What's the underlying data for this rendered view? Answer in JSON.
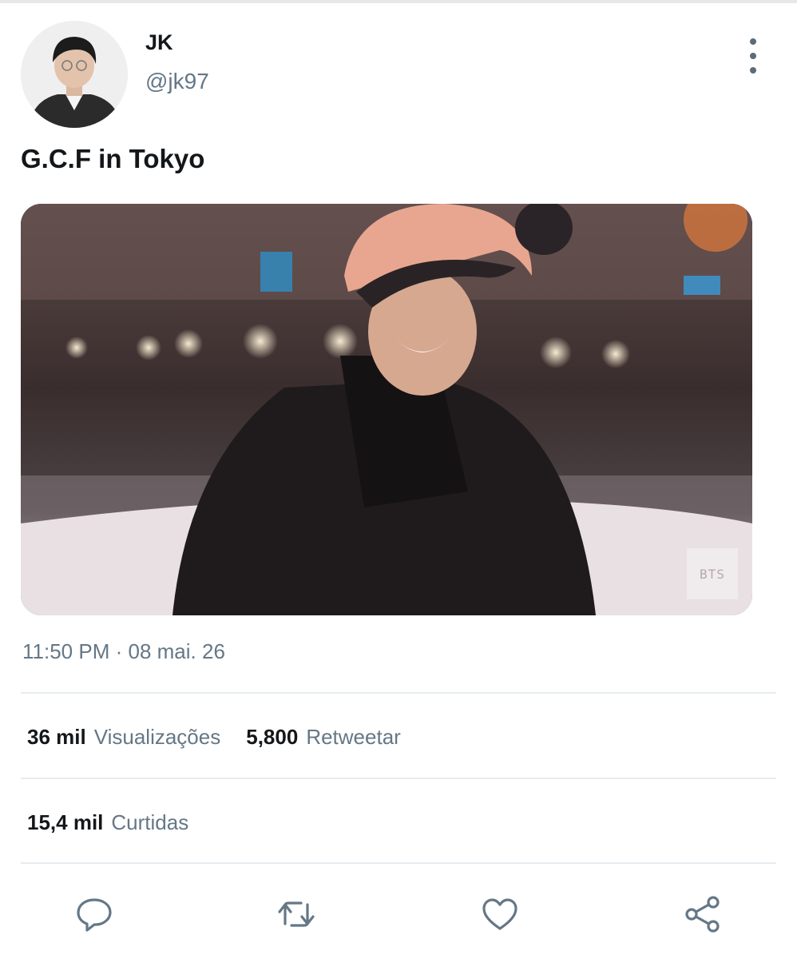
{
  "user": {
    "display_name": "JK",
    "handle": "@jk97"
  },
  "tweet": {
    "text": "G.C.F in Tokyo",
    "media_watermark": "BTS",
    "time": "11:50 PM",
    "separator": "·",
    "date": "08 mai. 26"
  },
  "stats": {
    "views_count": "36 mil",
    "views_label": "Visualizações",
    "retweets_count": "5,800",
    "retweets_label": "Retweetar",
    "likes_count": "15,4 mil",
    "likes_label": "Curtidas"
  },
  "actions": {
    "icons": [
      "reply-icon",
      "retweet-icon",
      "like-icon",
      "share-icon"
    ]
  },
  "colors": {
    "text_primary": "#14171a",
    "text_secondary": "#657786",
    "divider": "#e6ecf0"
  }
}
